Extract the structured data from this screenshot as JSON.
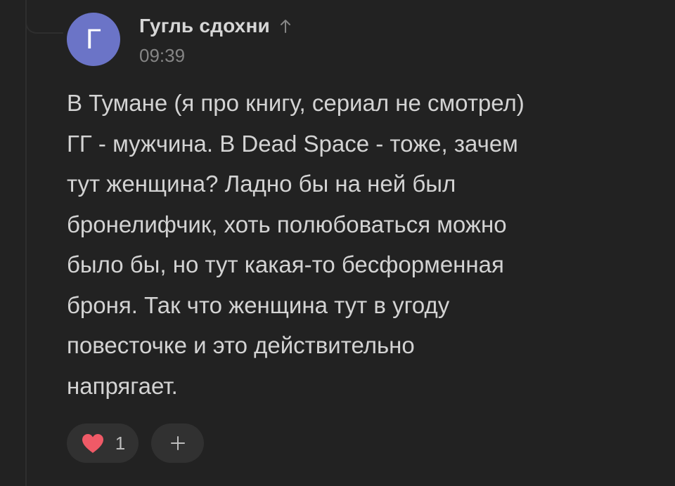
{
  "comment": {
    "avatar_letter": "Г",
    "avatar_color": "#6b74c7",
    "author": "Гугль сдохни",
    "time": "09:39",
    "reply_arrow_icon": "arrow-up-icon",
    "text_lines": [
      "В Тумане (я про книгу, сериал не смотрел)",
      "ГГ - мужчина. В Dead Space - тоже, зачем",
      "тут женщина? Ладно бы на ней был",
      "бронелифчик, хоть полюбоваться можно",
      "было бы, но тут какая-то бесформенная",
      "броня. Так что женщина тут в угоду",
      "повесточке и это действительно",
      "напрягает."
    ]
  },
  "reactions": {
    "heart_icon": "heart-icon",
    "heart_color": "#ef5a67",
    "like_count": "1",
    "add_reaction_icon": "plus-icon"
  },
  "theme": {
    "background": "#222222",
    "pill_background": "#313131",
    "text_color": "#d3d3d3",
    "muted_color": "#858585"
  }
}
